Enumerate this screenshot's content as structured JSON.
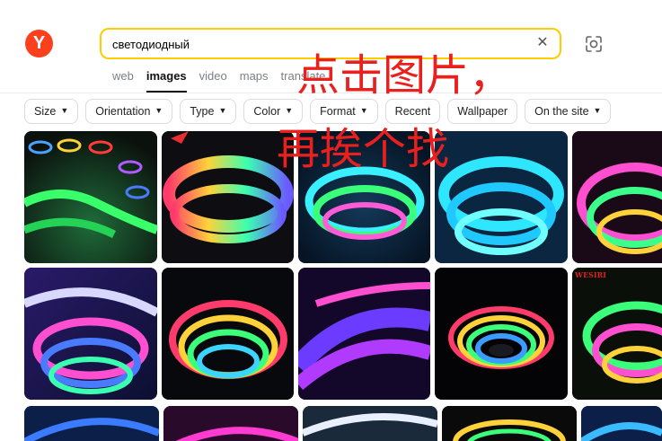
{
  "logo": {
    "letter": "Y",
    "brand_color": "#fc3f1d"
  },
  "search": {
    "value": "светодиодный",
    "clear_icon": "close-icon",
    "lens_icon": "camera-lens-icon",
    "border_color": "#ffcc00"
  },
  "tabs": [
    {
      "label": "web",
      "active": false
    },
    {
      "label": "images",
      "active": true
    },
    {
      "label": "video",
      "active": false
    },
    {
      "label": "maps",
      "active": false
    },
    {
      "label": "translate",
      "active": false
    }
  ],
  "filters": [
    {
      "label": "Size",
      "chevron": true
    },
    {
      "label": "Orientation",
      "chevron": true
    },
    {
      "label": "Type",
      "chevron": true
    },
    {
      "label": "Color",
      "chevron": true
    },
    {
      "label": "Format",
      "chevron": true
    },
    {
      "label": "Recent",
      "chevron": false
    },
    {
      "label": "Wallpaper",
      "chevron": false
    },
    {
      "label": "On the site",
      "chevron": true
    }
  ],
  "overlay": {
    "line1": "点击图片，",
    "line2": "再挨个找",
    "color": "#e8201e"
  },
  "images": {
    "row1": [
      {
        "id": "r1-1",
        "theme": "green"
      },
      {
        "id": "r1-2",
        "theme": "rainbow"
      },
      {
        "id": "r1-3",
        "theme": "blue-green"
      },
      {
        "id": "r1-4",
        "theme": "cyan"
      },
      {
        "id": "r1-5",
        "theme": "pink"
      }
    ],
    "row2": [
      {
        "id": "r2-1",
        "theme": "purple-pink"
      },
      {
        "id": "r2-2",
        "theme": "rainbow-dark"
      },
      {
        "id": "r2-3",
        "theme": "purple"
      },
      {
        "id": "r2-4",
        "theme": "rainbow-reel"
      },
      {
        "id": "r2-5",
        "theme": "rainbow-brand",
        "badge": "WESIRI"
      }
    ],
    "row3": [
      {
        "id": "r3-1",
        "theme": "blue"
      },
      {
        "id": "r3-2",
        "theme": "magenta"
      },
      {
        "id": "r3-3",
        "theme": "white"
      },
      {
        "id": "r3-4",
        "theme": "rainbow-reel"
      },
      {
        "id": "r3-5",
        "theme": "blue"
      }
    ]
  }
}
